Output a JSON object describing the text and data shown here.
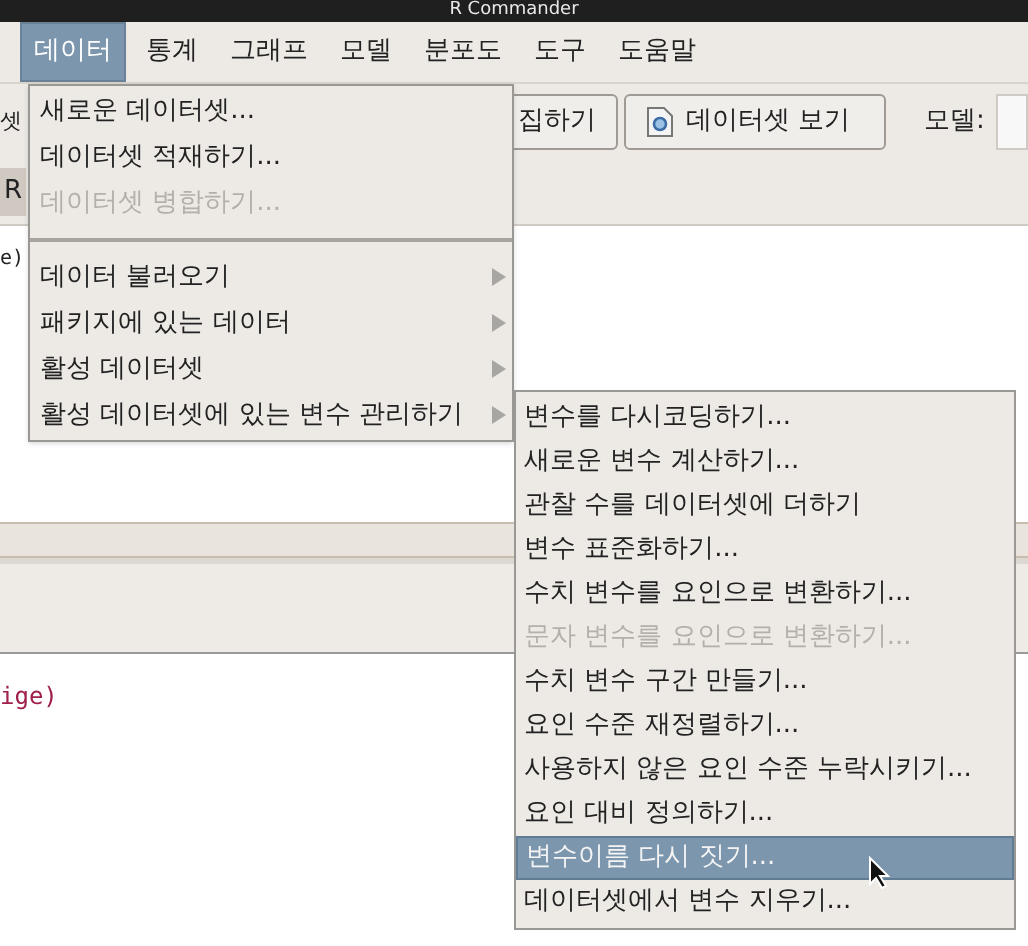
{
  "window": {
    "title": "R Commander"
  },
  "menubar": [
    {
      "label": "데이터",
      "selected": true
    },
    {
      "label": "통계",
      "selected": false
    },
    {
      "label": "그래프",
      "selected": false
    },
    {
      "label": "모델",
      "selected": false
    },
    {
      "label": "분포도",
      "selected": false
    },
    {
      "label": "도구",
      "selected": false
    },
    {
      "label": "도움말",
      "selected": false
    }
  ],
  "toolbar": {
    "label_fragment": "셋",
    "buttons": [
      {
        "label": "집하기",
        "icon": false
      },
      {
        "label": "데이터셋 보기",
        "icon": true
      }
    ],
    "model_label": "모델:"
  },
  "row_fragment": "R",
  "script_fragment": "e)",
  "output_fragment": "ige)",
  "data_menu": [
    {
      "kind": "item",
      "label": "새로운 데이터셋...",
      "disabled": false,
      "submenu": false
    },
    {
      "kind": "item",
      "label": "데이터셋 적재하기...",
      "disabled": false,
      "submenu": false
    },
    {
      "kind": "item",
      "label": "데이터셋 병합하기...",
      "disabled": true,
      "submenu": false
    },
    {
      "kind": "separator"
    },
    {
      "kind": "item",
      "label": "데이터 불러오기",
      "disabled": false,
      "submenu": true
    },
    {
      "kind": "item",
      "label": "패키지에 있는 데이터",
      "disabled": false,
      "submenu": true
    },
    {
      "kind": "item",
      "label": "활성 데이터셋",
      "disabled": false,
      "submenu": true
    },
    {
      "kind": "item",
      "label": "활성 데이터셋에 있는 변수 관리하기",
      "disabled": false,
      "submenu": true
    }
  ],
  "variables_submenu": [
    {
      "label": "변수를 다시코딩하기...",
      "disabled": false,
      "selected": false
    },
    {
      "label": "새로운 변수 계산하기...",
      "disabled": false,
      "selected": false
    },
    {
      "label": "관찰 수를 데이터셋에 더하기",
      "disabled": false,
      "selected": false
    },
    {
      "label": "변수 표준화하기...",
      "disabled": false,
      "selected": false
    },
    {
      "label": "수치 변수를 요인으로 변환하기...",
      "disabled": false,
      "selected": false
    },
    {
      "label": "문자 변수를 요인으로 변환하기...",
      "disabled": true,
      "selected": false
    },
    {
      "label": "수치 변수 구간 만들기...",
      "disabled": false,
      "selected": false
    },
    {
      "label": "요인 수준 재정렬하기...",
      "disabled": false,
      "selected": false
    },
    {
      "label": "사용하지 않은 요인 수준 누락시키기...",
      "disabled": false,
      "selected": false
    },
    {
      "label": "요인 대비 정의하기...",
      "disabled": false,
      "selected": false
    },
    {
      "label": "변수이름 다시 짓기...",
      "disabled": false,
      "selected": true
    },
    {
      "label": "데이터셋에서 변수 지우기...",
      "disabled": false,
      "selected": false
    }
  ]
}
